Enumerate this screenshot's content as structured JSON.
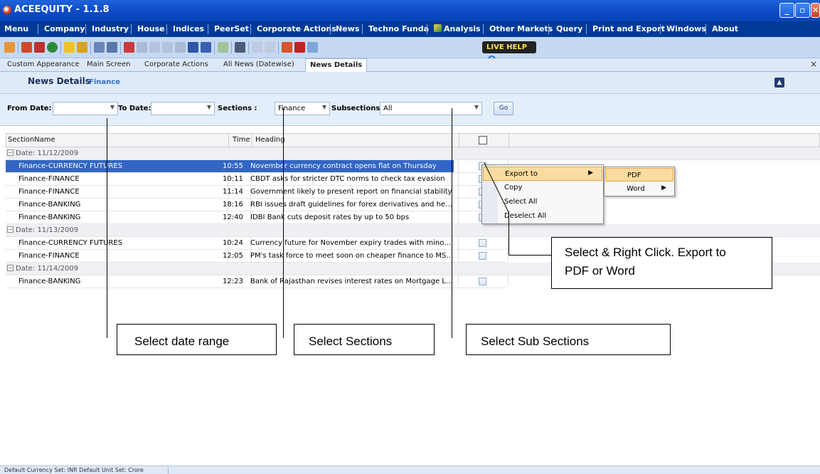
{
  "window": {
    "title": "ACEEQUITY  - 1.1.8"
  },
  "menu": {
    "items": [
      "Menu",
      "Company",
      "Industry",
      "House",
      "Indices",
      "PeerSet",
      "Corporate Actions",
      "News",
      "Techno Funda",
      "Analysis",
      "Other Markets",
      "Query",
      "Print and Export",
      "Windows",
      "About"
    ]
  },
  "toolbar": {
    "live_help": "LIVE HELP"
  },
  "tabs": [
    "Custom Appearance",
    "Main Screen",
    "Corporate Actions",
    "All News (Datewise)",
    "News Details"
  ],
  "header": {
    "title": "News Details",
    "subtitle": "Finance"
  },
  "filters": {
    "from_date_label": "From Date:",
    "from_date_value": "",
    "to_date_label": "To Date:",
    "to_date_value": "",
    "sections_label": "Sections :",
    "sections_value": "Finance",
    "subsections_label": "Subsections :",
    "subsections_value": "All",
    "go_label": "Go"
  },
  "grid": {
    "columns": [
      "SectionName",
      "Time",
      "Heading"
    ],
    "groups": [
      {
        "label": "Date: 11/12/2009",
        "rows": [
          {
            "section": "Finance-CURRENCY FUTURES",
            "time": "10:55",
            "heading": "November currency contract opens flat on Thursday",
            "selected": true
          },
          {
            "section": "Finance-FINANCE",
            "time": "10:11",
            "heading": "CBDT asks for stricter DTC norms to check tax evasion",
            "selected": false
          },
          {
            "section": "Finance-FINANCE",
            "time": "11:14",
            "heading": "Government likely to present report on financial stability",
            "selected": false
          },
          {
            "section": "Finance-BANKING",
            "time": "18:16",
            "heading": "RBI issues draft guidelines for forex derivatives and hedging",
            "selected": false
          },
          {
            "section": "Finance-BANKING",
            "time": "12:40",
            "heading": "IDBI Bank cuts deposit rates by up to 50 bps",
            "selected": false
          }
        ]
      },
      {
        "label": "Date: 11/13/2009",
        "rows": [
          {
            "section": "Finance-CURRENCY FUTURES",
            "time": "10:24",
            "heading": "Currency future for November expiry trades with minor decrease ...",
            "selected": false
          },
          {
            "section": "Finance-FINANCE",
            "time": "12:05",
            "heading": "PM's task force to meet soon on cheaper finance to MSMEs",
            "selected": false
          }
        ]
      },
      {
        "label": "Date: 11/14/2009",
        "rows": [
          {
            "section": "Finance-BANKING",
            "time": "12:23",
            "heading": "Bank of Rajasthan revises interest rates on Mortgage Loan",
            "selected": false
          }
        ]
      }
    ]
  },
  "context_menu": {
    "items": [
      "Export to",
      "Copy",
      "Select All",
      "Deselect All"
    ],
    "export_submenu": [
      "PDF",
      "Word"
    ]
  },
  "callouts": {
    "date_range": "Select date range",
    "sections": "Select Sections",
    "sub_sections": "Select Sub Sections",
    "export_line1": "Select & Right Click. Export to",
    "export_line2": "PDF or Word"
  },
  "status": {
    "text": "Default Currency Set: INR  Default Unit Set: Crore"
  },
  "colors": {
    "title_bar": "#0b4ac6",
    "menu_bar": "#003a99",
    "selection": "#3166c4",
    "menu_highlight": "#fbdca0"
  }
}
